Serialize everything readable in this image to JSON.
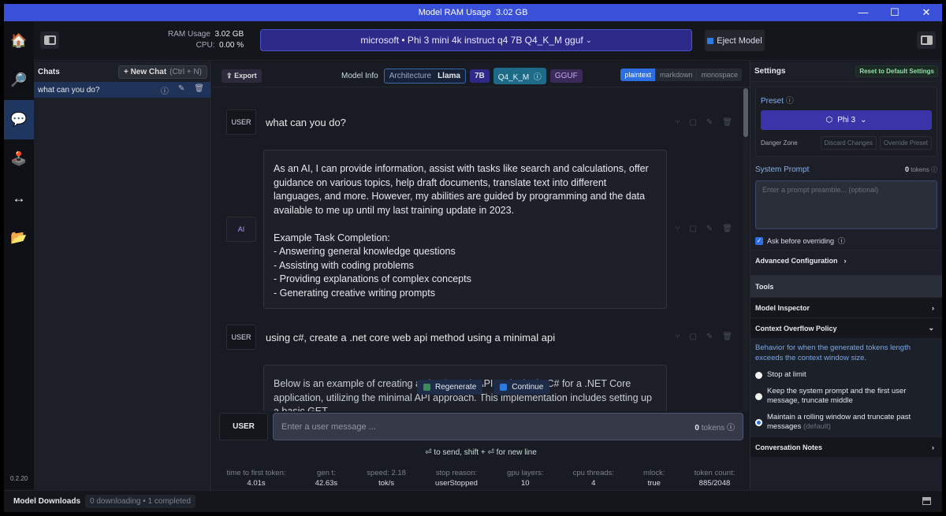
{
  "window": {
    "title": "Model RAM Usage",
    "title_value": "3.02 GB",
    "controls": [
      "minimize",
      "maximize",
      "close"
    ]
  },
  "rail": {
    "items": [
      {
        "name": "home",
        "icon": "🏠"
      },
      {
        "name": "search",
        "icon": "🔎"
      },
      {
        "name": "chat",
        "icon": "💬",
        "active": true
      },
      {
        "name": "playground",
        "icon": "🕹️"
      },
      {
        "name": "server",
        "icon": "↔"
      },
      {
        "name": "folders",
        "icon": "📂"
      }
    ],
    "version": "0.2.20"
  },
  "topbar": {
    "ram_label": "RAM Usage",
    "ram_value": "3.02 GB",
    "cpu_label": "CPU:",
    "cpu_value": "0.00 %",
    "model_selector": "microsoft • Phi 3 mini 4k instruct q4 7B Q4_K_M gguf",
    "eject_label": "Eject Model"
  },
  "chats": {
    "title": "Chats",
    "new_chat_label": "+ New Chat",
    "new_chat_shortcut": "(Ctrl + N)",
    "items": [
      {
        "label": "what can you do?",
        "selected": true
      }
    ]
  },
  "toolbar": {
    "export_label": "Export",
    "model_info_label": "Model Info",
    "architecture_label": "Architecture",
    "architecture_value": "Llama",
    "size": "7B",
    "quant": "Q4_K_M",
    "format": "GGUF",
    "text_modes": [
      "plaintext",
      "markdown",
      "monospace"
    ],
    "active_mode": "plaintext"
  },
  "messages": [
    {
      "role": "USER",
      "text": "what can you do?"
    },
    {
      "role": "AI",
      "text": "As an AI, I can provide information, assist with tasks like search and calculations, offer guidance on various topics, help draft documents, translate text into different languages, and more. However, my abilities are guided by programming and the data available to me up until my last training update in 2023.\n\nExample Task Completion:\n- Answering general knowledge questions\n- Assisting with coding problems\n- Providing explanations of complex concepts\n- Generating creative writing prompts"
    },
    {
      "role": "USER",
      "text": "using c#, create a .net core web api method using a minimal api"
    },
    {
      "role": "AI",
      "text": "Below is an example of creating a simple Web API endpoint in C# for a .NET Core application, utilizing the minimal API approach. This implementation includes setting up a basic GET"
    }
  ],
  "float_actions": {
    "regenerate": "Regenerate",
    "continue": "Continue"
  },
  "composer": {
    "role": "USER",
    "placeholder": "Enter a user message ...",
    "tokens_value": "0",
    "tokens_label": "tokens",
    "hint": "⏎ to send, shift + ⏎ for new line"
  },
  "stats": [
    {
      "label": "time to first token:",
      "value": "4.01s"
    },
    {
      "label": "gen t:",
      "value": "42.63s"
    },
    {
      "label": "speed: 2.18",
      "value": "tok/s"
    },
    {
      "label": "stop reason:",
      "value": "userStopped"
    },
    {
      "label": "gpu layers:",
      "value": "10"
    },
    {
      "label": "cpu threads:",
      "value": "4"
    },
    {
      "label": "mlock:",
      "value": "true"
    },
    {
      "label": "token count:",
      "value": "885/2048"
    }
  ],
  "settings": {
    "title": "Settings",
    "reset_label": "Reset to Default Settings",
    "preset_label": "Preset",
    "preset_value": "Phi 3",
    "danger_zone": "Danger Zone",
    "discard_label": "Discard Changes",
    "override_label": "Override Preset",
    "system_prompt_label": "System Prompt",
    "system_prompt_tokens": "0",
    "tokens_label": "tokens",
    "system_prompt_placeholder": "Enter a prompt preamble... (optional)",
    "ask_before_overriding": "Ask before overriding",
    "ask_checked": true,
    "advanced_config": "Advanced Configuration",
    "tools": "Tools",
    "model_inspector": "Model Inspector",
    "context_overflow": "Context Overflow Policy",
    "context_desc": "Behavior for when the generated tokens length exceeds the context window size.",
    "policies": [
      {
        "label": "Stop at limit",
        "selected": false
      },
      {
        "label": "Keep the system prompt and the first user message, truncate middle",
        "selected": false
      },
      {
        "label": "Maintain a rolling window and truncate past messages",
        "suffix": "(default)",
        "selected": true
      }
    ],
    "conversation_notes": "Conversation Notes"
  },
  "bottom": {
    "downloads_label": "Model Downloads",
    "downloads_status": "0 downloading • 1 completed"
  }
}
